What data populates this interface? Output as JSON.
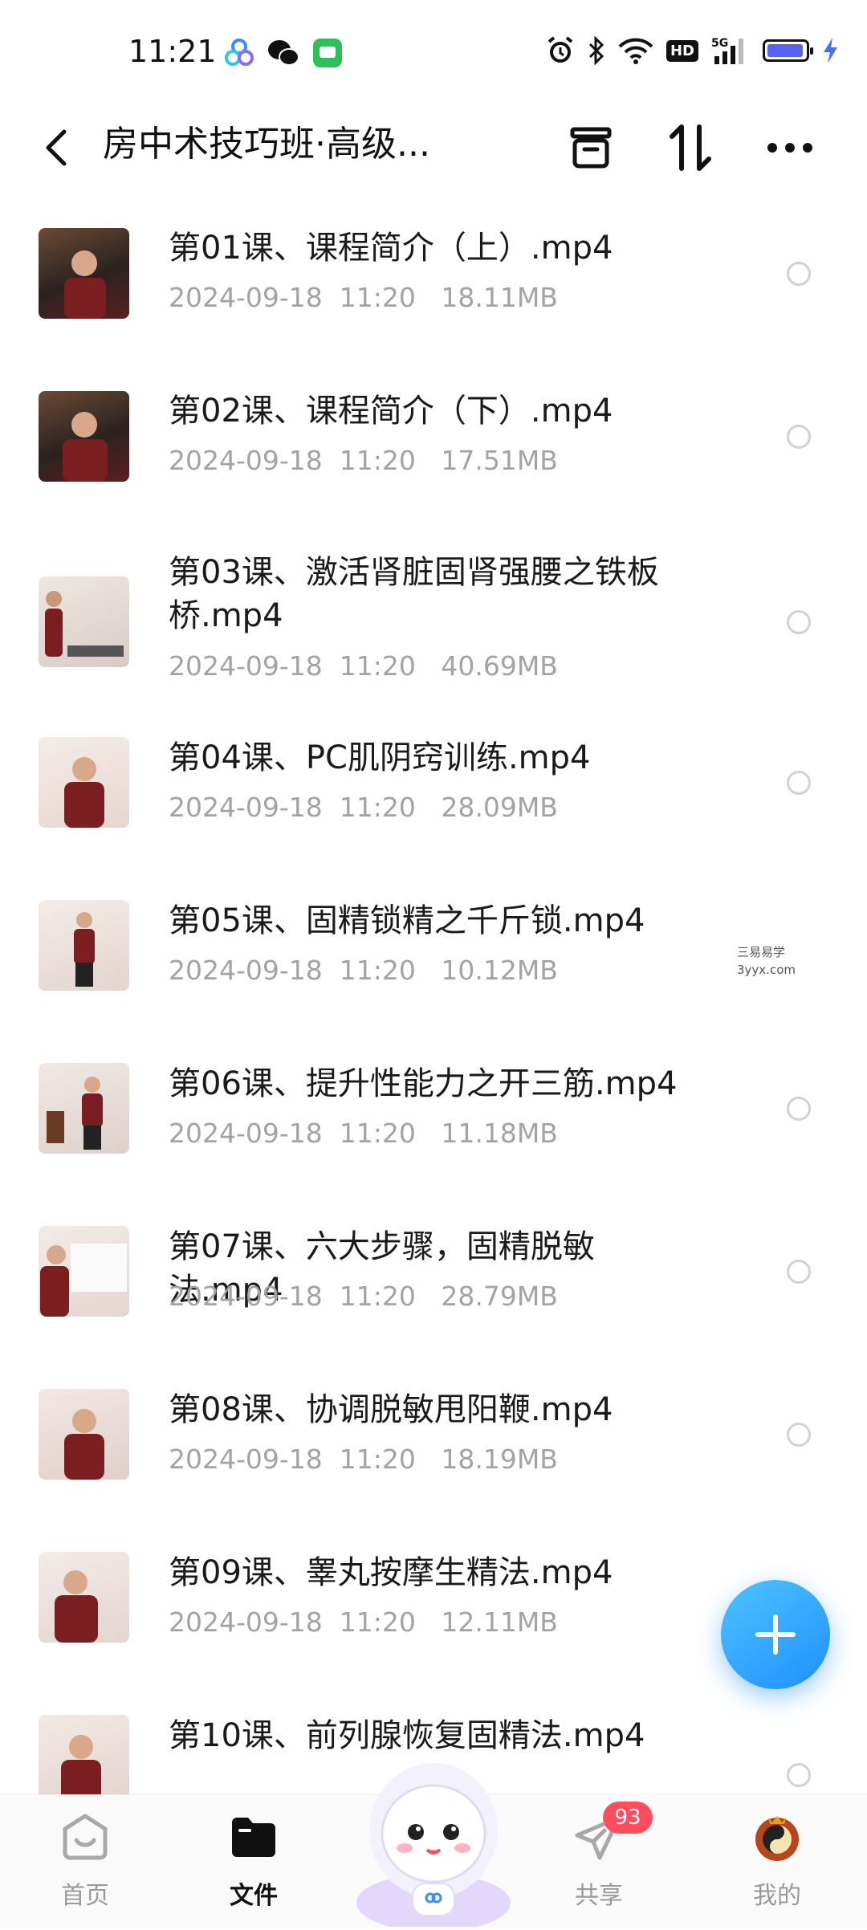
{
  "status_bar": {
    "time": "11:21",
    "hd": "HD",
    "network": "5G"
  },
  "header": {
    "title": "房中术技巧班·高级..."
  },
  "files": [
    {
      "name": "第01课、课程简介（上）.mp4",
      "date": "2024-09-18  11:20",
      "size": "18.11MB"
    },
    {
      "name": "第02课、课程简介（下）.mp4",
      "date": "2024-09-18  11:20",
      "size": "17.51MB"
    },
    {
      "name": "第03课、激活肾脏固肾强腰之铁板桥.mp4",
      "date": "2024-09-18  11:20",
      "size": "40.69MB"
    },
    {
      "name": "第04课、PC肌阴窍训练.mp4",
      "date": "2024-09-18  11:20",
      "size": "28.09MB"
    },
    {
      "name": "第05课、固精锁精之千斤锁.mp4",
      "date": "2024-09-18  11:20",
      "size": "10.12MB"
    },
    {
      "name": "第06课、提升性能力之开三筋.mp4",
      "date": "2024-09-18  11:20",
      "size": "11.18MB"
    },
    {
      "name": "第07课、六大步骤，固精脱敏法.mp4",
      "date": "2024-09-18  11:20",
      "size": "28.79MB"
    },
    {
      "name": "第08课、协调脱敏甩阳鞭.mp4",
      "date": "2024-09-18  11:20",
      "size": "18.19MB"
    },
    {
      "name": "第09课、睾丸按摩生精法.mp4",
      "date": "2024-09-18  11:20",
      "size": "12.11MB"
    },
    {
      "name": "第10课、前列腺恢复固精法.mp4",
      "date": "",
      "size": ""
    }
  ],
  "watermark": {
    "line1": "三易易学",
    "line2": "3yyx.com"
  },
  "nav": {
    "home": "首页",
    "files": "文件",
    "share": "共享",
    "mine": "我的",
    "share_badge": "93"
  },
  "colors": {
    "accent": "#1f8fff",
    "badge": "#ff4d5e",
    "meta_text": "#a3a3a3"
  }
}
